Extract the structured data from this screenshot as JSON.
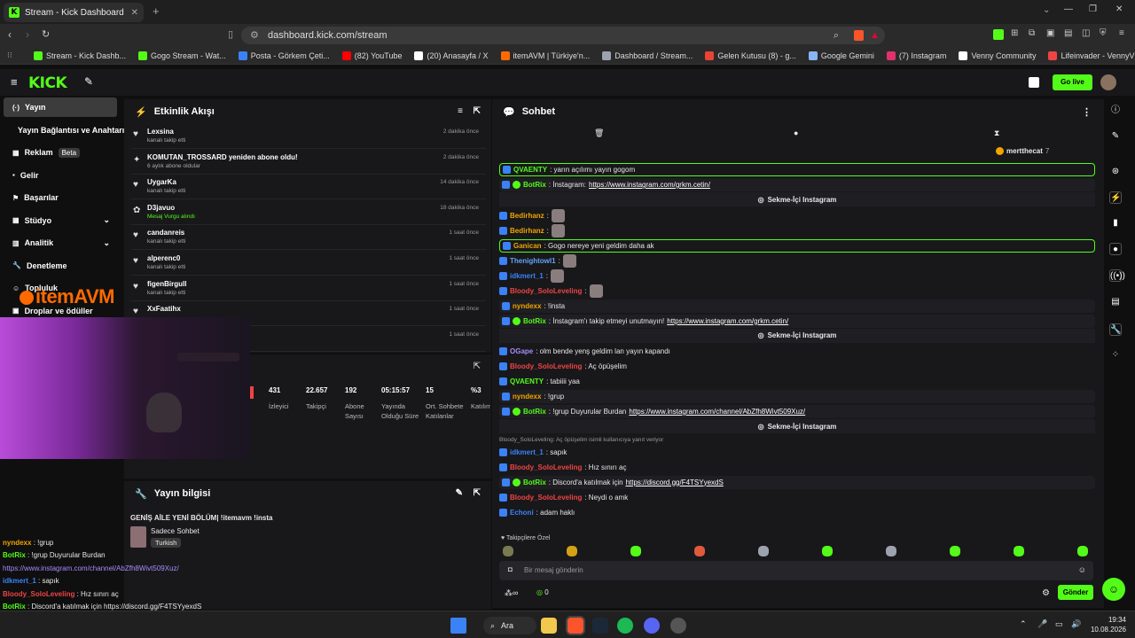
{
  "browser": {
    "tab_title": "Stream - Kick Dashboard",
    "url": "dashboard.kick.com/stream",
    "bookmarks": [
      {
        "label": "Stream - Kick Dashb...",
        "color": "#53fc18"
      },
      {
        "label": "Gogo Stream - Wat...",
        "color": "#53fc18"
      },
      {
        "label": "Posta - Görkem Çeti...",
        "color": "#3b82f6"
      },
      {
        "label": "(82) YouTube",
        "color": "#ff0000"
      },
      {
        "label": "(20) Anasayfa / X",
        "color": "#ffffff"
      },
      {
        "label": "itemAVM | Türkiye'n...",
        "color": "#ff6a00"
      },
      {
        "label": "Dashboard / Stream...",
        "color": "#9ca3af"
      },
      {
        "label": "Gelen Kutusu (8) - g...",
        "color": "#ea4335"
      },
      {
        "label": "Google Gemini",
        "color": "#8ab4f8"
      },
      {
        "label": "(7) Instagram",
        "color": "#e1306c"
      },
      {
        "label": "Venny Community",
        "color": "#ffffff"
      },
      {
        "label": "Lifeinvader - VennyV",
        "color": "#ef4444"
      }
    ]
  },
  "topnav": {
    "logo": "KICK",
    "go_live": "Go live"
  },
  "sidebar": [
    {
      "label": "Yayın",
      "active": true
    },
    {
      "label": "Yayın Bağlantısı ve Anahtarı"
    },
    {
      "label": "Reklam",
      "badge": "Beta"
    },
    {
      "label": "Gelir"
    },
    {
      "label": "Başarılar"
    },
    {
      "label": "Stüdyo"
    },
    {
      "label": "Analitik"
    },
    {
      "label": "Denetleme"
    },
    {
      "label": "Topluluk"
    },
    {
      "label": "Droplar ve ödüller"
    }
  ],
  "activity": {
    "title": "Etkinlik Akışı",
    "items": [
      {
        "name": "Lexsina",
        "sub": "kanalı takip etti",
        "time": "2 dakika önce"
      },
      {
        "name": "KOMUTAN_TROSSARD yeniden abone oldu!",
        "sub": "6 aylık abone oldular",
        "time": "2 dakika önce"
      },
      {
        "name": "UygarKa",
        "sub": "kanalı takip etti",
        "time": "14 dakika önce"
      },
      {
        "name": "D3javuo",
        "sub": "Mesaj Vurgu alındı",
        "time": "18 dakika önce"
      },
      {
        "name": "candanreis",
        "sub": "kanalı takip etti",
        "time": "1 saat önce"
      },
      {
        "name": "alperenc0",
        "sub": "kanalı takip etti",
        "time": "1 saat önce"
      },
      {
        "name": "figenBirgull",
        "sub": "kanalı takip etti",
        "time": "1 saat önce"
      },
      {
        "name": "XxFaatihx",
        "sub": "",
        "time": "1 saat önce"
      },
      {
        "name": "",
        "sub": "",
        "time": "1 saat önce"
      }
    ]
  },
  "stats": [
    {
      "value": "431",
      "label": "İzleyici"
    },
    {
      "value": "22.657",
      "label": "Takipçi"
    },
    {
      "value": "192",
      "label": "Abone Sayısı"
    },
    {
      "value": "05:15:57",
      "label": "Yayında Olduğu Süre"
    },
    {
      "value": "15",
      "label": "Ort. Sohbete Katılanlar"
    },
    {
      "value": "%3",
      "label": "Katılım"
    }
  ],
  "stream_info": {
    "title": "Yayın bilgisi",
    "stream_title": "GENİŞ AİLE YENİ BÖLÜM| !itemavm !insta",
    "category": "Sadece Sohbet",
    "tag": "Turkish"
  },
  "webcam": {
    "overlay_logo": "itemAVM"
  },
  "overlay_chat": [
    {
      "user": "nyndexx",
      "text": " : !grup",
      "color": "#f0a500"
    },
    {
      "user": "BotRix",
      "text": " : !grup Duyurular Burdan",
      "color": "#53fc18"
    },
    {
      "user": "",
      "text": "https://www.instagram.com/channel/AbZfh8Wivt509Xuz/",
      "color": "#a78bfa"
    },
    {
      "user": "idkmert_1",
      "text": " : sapık",
      "color": "#3b82f6"
    },
    {
      "user": "Bloody_SoloLeveling",
      "text": " : Hız sınırı aç",
      "color": "#ef4444"
    },
    {
      "user": "BotRix",
      "text": " : Discord'a katılmak için https://discord.gg/F4TSYyexdS",
      "color": "#53fc18"
    },
    {
      "user": "Bloody_SoloLeveling",
      "text": " : Neydi o amk",
      "color": "#ef4444"
    },
    {
      "user": "Echoni",
      "text": " : adam haklı",
      "color": "#3b82f6"
    }
  ],
  "chat": {
    "title": "Sohbet",
    "pinned_user": "mertthecat",
    "pinned_count": "7",
    "messages": [
      {
        "user": "QVAENTY",
        "text": ": yarın açılımı yayın gogom",
        "color": "#53fc18",
        "style": "hl"
      },
      {
        "user": "BotRix",
        "text": ": İnstagram: ",
        "link": "https://www.instagram.com/grkm.cetin/",
        "color": "#53fc18",
        "style": "bx"
      },
      {
        "button": "Sekme-İçi Instagram"
      },
      {
        "user": "Bedirhanz",
        "text": ":",
        "color": "#f0a500",
        "emote": true
      },
      {
        "user": "Bedirhanz",
        "text": ":",
        "color": "#f0a500",
        "emote": true
      },
      {
        "user": "Ganican",
        "text": ": Gogo nereye yeni geldim daha ak",
        "color": "#f0a500",
        "style": "hl"
      },
      {
        "user": "Thenightowl1",
        "text": ":",
        "color": "#60a5fa",
        "emote": true
      },
      {
        "user": "idkmert_1",
        "text": ":",
        "color": "#3b82f6",
        "emote": true
      },
      {
        "user": "Bloody_SoloLeveling",
        "text": ":",
        "color": "#ef4444",
        "emote": true
      },
      {
        "user": "nyndexx",
        "text": ": !insta",
        "color": "#f0a500",
        "style": "bx"
      },
      {
        "user": "BotRix",
        "text": ": İnstagram'ı takip etmeyi unutmayın! ",
        "link": "https://www.instagram.com/grkm.cetin/",
        "color": "#53fc18",
        "style": "bx"
      },
      {
        "button": "Sekme-İçi Instagram"
      },
      {
        "user": "OGape",
        "text": ": olm bende yenş geldim lan yayın kapandı",
        "color": "#a78bfa"
      },
      {
        "user": "Bloody_SoloLeveling",
        "text": ": Aç öpüşelim",
        "color": "#ef4444"
      },
      {
        "user": "QVAENTY",
        "text": ": tabiiii yaa",
        "color": "#53fc18"
      },
      {
        "user": "nyndexx",
        "text": ": !grup",
        "color": "#f0a500",
        "style": "bx"
      },
      {
        "user": "BotRix",
        "text": ": !grup Duyurular Burdan ",
        "link": "https://www.instagram.com/channel/AbZfh8Wivt509Xuz/",
        "color": "#53fc18",
        "style": "bx"
      },
      {
        "button": "Sekme-İçi Instagram"
      },
      {
        "reply": "Bloody_SoloLeveling: Aç öpüşelim isimli kullanıcıya yanıt veriyor"
      },
      {
        "user": "idkmert_1",
        "text": ": sapık",
        "color": "#3b82f6"
      },
      {
        "user": "Bloody_SoloLeveling",
        "text": ": Hız sınırı aç",
        "color": "#ef4444"
      },
      {
        "user": "BotRix",
        "text": ": Discord'a katılmak için ",
        "link": "https://discord.gg/F4TSYyexdS",
        "color": "#53fc18",
        "style": "bx"
      },
      {
        "user": "Bloody_SoloLeveling",
        "text": ": Neydi o amk",
        "color": "#ef4444"
      },
      {
        "user": "Echoni",
        "text": ": adam haklı",
        "color": "#3b82f6"
      }
    ],
    "emote_section": "Takipçilere Özel",
    "input_placeholder": "Bir mesaj gönderin",
    "points": "0",
    "send": "Gönder"
  },
  "taskbar": {
    "search": "Ara",
    "time": "19:34",
    "date": "10.08.2026"
  }
}
